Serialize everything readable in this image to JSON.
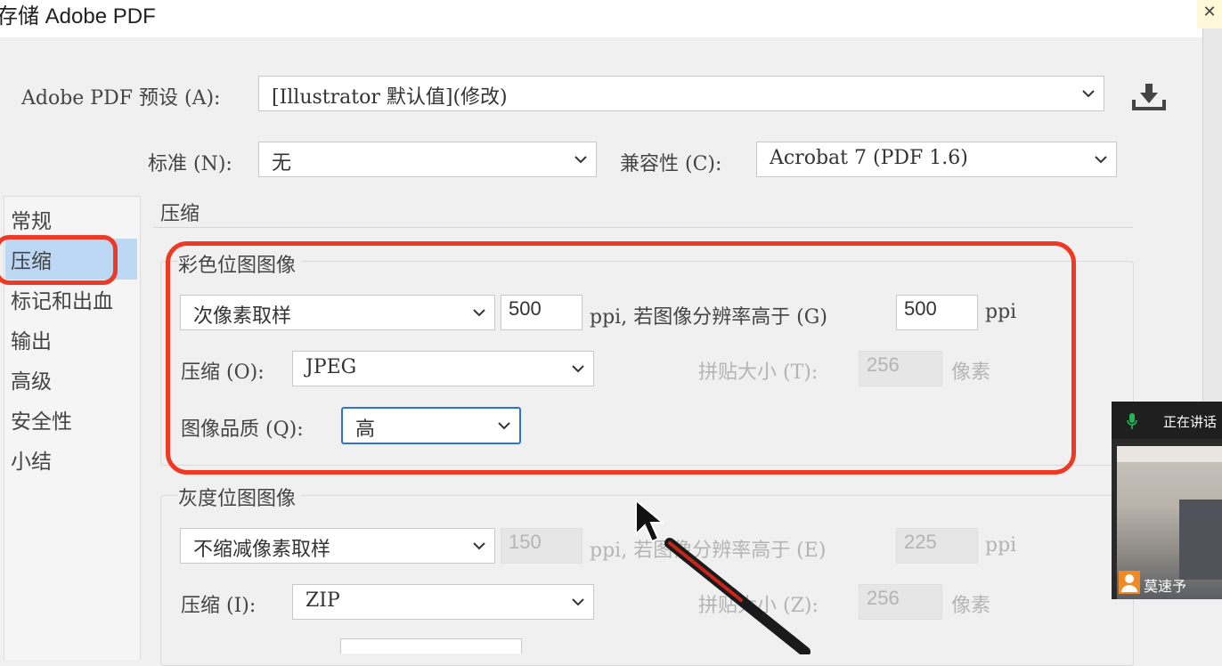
{
  "window": {
    "title": "存储 Adobe PDF"
  },
  "header": {
    "preset_label": "Adobe PDF 预设 (A):",
    "preset_value": "[Illustrator 默认值](修改)",
    "standard_label": "标准 (N):",
    "standard_value": "无",
    "compat_label": "兼容性 (C):",
    "compat_value": "Acrobat 7 (PDF 1.6)",
    "save_preset_icon": "download-icon"
  },
  "sidebar": {
    "items": [
      {
        "label": "常规"
      },
      {
        "label": "压缩"
      },
      {
        "label": "标记和出血"
      },
      {
        "label": "输出"
      },
      {
        "label": "高级"
      },
      {
        "label": "安全性"
      },
      {
        "label": "小结"
      }
    ],
    "selected": "压缩"
  },
  "panel": {
    "title": "压缩",
    "color_bitmap": {
      "title": "彩色位图图像",
      "resample_value": "次像素取样",
      "resample_ppi": "500",
      "ppi_label": "ppi, 若图像分辨率高于 (G)",
      "threshold_ppi": "500",
      "ppi_unit": "ppi",
      "compression_label": "压缩 (O):",
      "compression_value": "JPEG",
      "tile_label": "拼贴大小 (T):",
      "tile_value": "256",
      "tile_unit": "像素",
      "quality_label": "图像品质 (Q):",
      "quality_value": "高"
    },
    "gray_bitmap": {
      "title": "灰度位图图像",
      "resample_value": "不缩减像素取样",
      "resample_ppi": "150",
      "ppi_label": "ppi, 若图像分辨率高于 (E)",
      "threshold_ppi": "225",
      "ppi_unit": "ppi",
      "compression_label": "压缩 (I):",
      "compression_value": "ZIP",
      "tile_label": "拼贴大小 (Z):",
      "tile_value": "256",
      "tile_unit": "像素"
    }
  },
  "meeting_overlay": {
    "speaking_label": "正在讲话",
    "participant_name": "莫速予"
  },
  "colors": {
    "annotation_red": "#ee3a24",
    "selection_blue": "#bcd8f4",
    "focus_blue": "#2b74d6"
  }
}
